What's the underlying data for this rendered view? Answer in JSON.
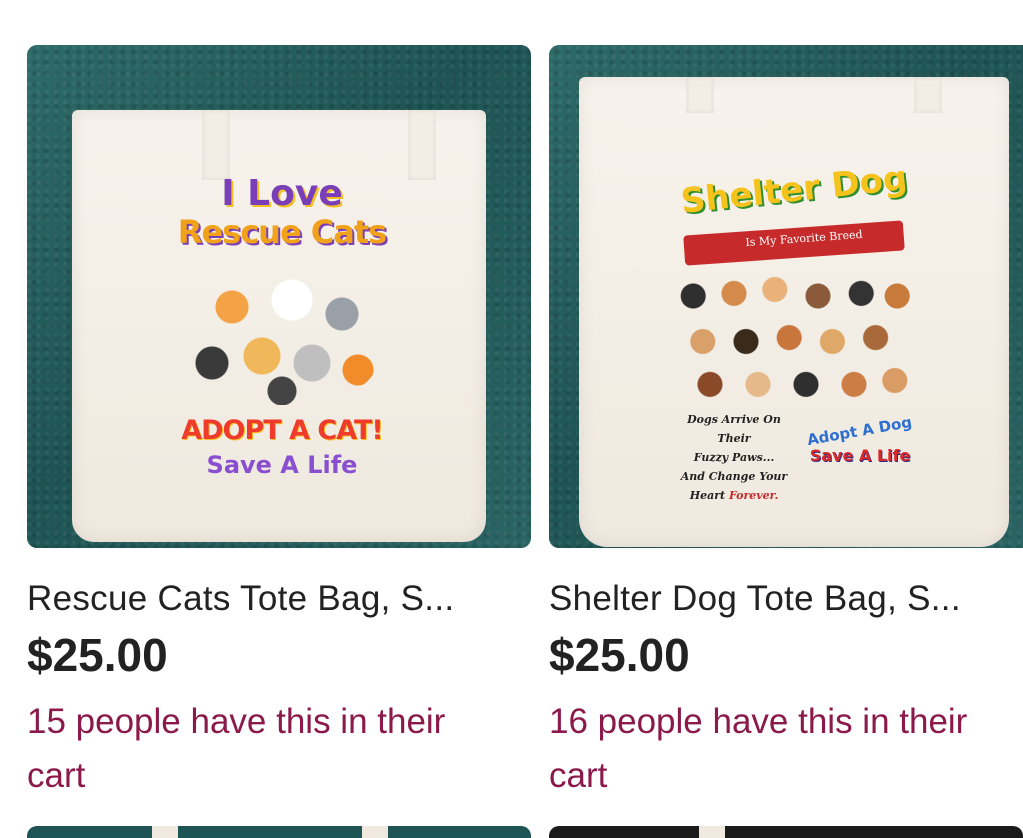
{
  "listings": [
    {
      "title": "Rescue Cats Tote Bag, S...",
      "price": "$25.00",
      "cart_note": "15 people have this in their cart",
      "image": {
        "line1": "I Love",
        "line2": "Rescue Cats",
        "line3": "ADOPT A CAT!",
        "line4": "Save A Life"
      }
    },
    {
      "title": "Shelter Dog Tote Bag, S...",
      "price": "$25.00",
      "cart_note": "16 people have this in their cart",
      "image": {
        "title": "Shelter Dog",
        "subtitle": "Is My Favorite Breed",
        "text1": "Dogs Arrive On Their",
        "text2": "Fuzzy Paws...",
        "text3": "And Change Your",
        "text4": "Heart",
        "text5": "Forever.",
        "badge1": "Adopt A Dog",
        "badge2": "Save A Life"
      }
    }
  ],
  "colors": {
    "price_text": "#222222",
    "cart_note_text": "#8b1a4a",
    "image_background": "#1f5454"
  }
}
